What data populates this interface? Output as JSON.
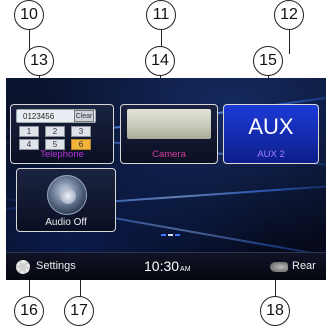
{
  "callouts": [
    "10",
    "11",
    "12",
    "13",
    "14",
    "15",
    "16",
    "17",
    "18"
  ],
  "telephone": {
    "number": "0123456",
    "clear_label": "Clear",
    "keys": [
      "1",
      "2",
      "3",
      "4",
      "5",
      "6"
    ],
    "label": "Telephone"
  },
  "camera": {
    "label": "Camera"
  },
  "aux": {
    "big_label": "AUX",
    "label": "AUX 2"
  },
  "audio": {
    "label": "Audio Off"
  },
  "bottom_bar": {
    "settings_label": "Settings",
    "time": "10:30",
    "ampm": "AM",
    "rear_label": "Rear"
  },
  "colors": {
    "telephone_label": "#b533d6",
    "camera_label": "#d63a9a",
    "aux_label": "#a07cff",
    "accent": "#3a7bff"
  },
  "icons": {
    "settings": "gear-icon",
    "rear": "rear-speaker-icon",
    "audio": "audio-knob-icon",
    "camera": "rear-camera-icon"
  }
}
